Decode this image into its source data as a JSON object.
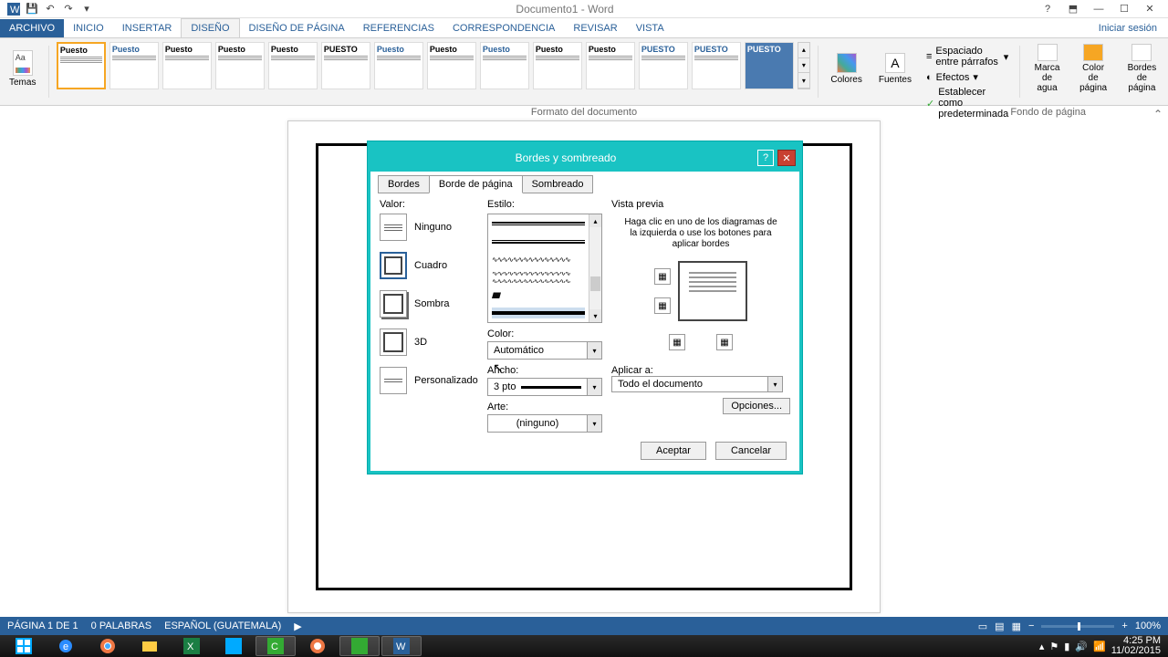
{
  "app": {
    "title": "Documento1 - Word"
  },
  "qat": {
    "word": "W",
    "save": "💾",
    "undo": "↶",
    "redo": "↷"
  },
  "win": {
    "help": "?",
    "min": "—",
    "max": "☐",
    "close": "✕"
  },
  "tabs": {
    "file": "ARCHIVO",
    "home": "INICIO",
    "insert": "INSERTAR",
    "design": "DISEÑO",
    "layout": "DISEÑO DE PÁGINA",
    "refs": "REFERENCIAS",
    "mail": "CORRESPONDENCIA",
    "review": "REVISAR",
    "view": "VISTA",
    "signin": "Iniciar sesión"
  },
  "ribbon": {
    "themes": "Temas",
    "style_title1": "Puesto",
    "style_title2": "Puesto",
    "style_title3": "Puesto",
    "style_title4": "Puesto",
    "style_title5": "Puesto",
    "style_title6": "PUESTO",
    "style_title7": "Puesto",
    "style_title8": "Puesto",
    "style_title9": "Puesto",
    "style_title10": "Puesto",
    "style_title11": "Puesto",
    "style_title12": "PUESTO",
    "style_title13": "PUESTO",
    "colors": "Colores",
    "fonts": "Fuentes",
    "para_spacing": "Espaciado entre párrafos",
    "effects": "Efectos",
    "set_default": "Establecer como predeterminada",
    "watermark": "Marca de agua",
    "page_color": "Color de página",
    "page_borders": "Bordes de página",
    "group_doc": "Formato del documento",
    "group_bg": "Fondo de página"
  },
  "dialog": {
    "title": "Bordes y sombreado",
    "tab_borders": "Bordes",
    "tab_page": "Borde de página",
    "tab_shading": "Sombreado",
    "setting_label": "Valor:",
    "setting_none": "Ninguno",
    "setting_box": "Cuadro",
    "setting_shadow": "Sombra",
    "setting_3d": "3D",
    "setting_custom": "Personalizado",
    "style_label": "Estilo:",
    "color_label": "Color:",
    "color_value": "Automático",
    "width_label": "Ancho:",
    "width_value": "3 pto",
    "art_label": "Arte:",
    "art_value": "(ninguno)",
    "preview_label": "Vista previa",
    "preview_hint": "Haga clic en uno de los diagramas de la izquierda o use los botones para aplicar bordes",
    "apply_label": "Aplicar a:",
    "apply_value": "Todo el documento",
    "options": "Opciones...",
    "ok": "Aceptar",
    "cancel": "Cancelar"
  },
  "status": {
    "page": "PÁGINA 1 DE 1",
    "words": "0 PALABRAS",
    "lang": "ESPAÑOL (GUATEMALA)",
    "zoom": "100%"
  },
  "tray": {
    "time": "4:25 PM",
    "date": "11/02/2015"
  }
}
